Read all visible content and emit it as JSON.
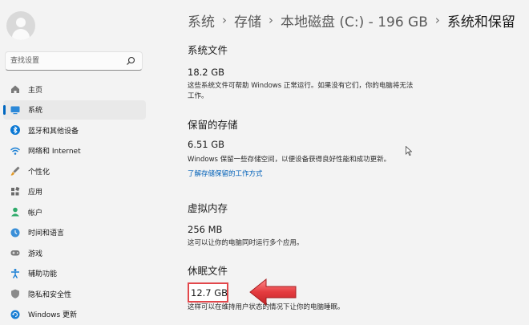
{
  "sidebar": {
    "search_placeholder": "查找设置",
    "items": [
      {
        "label": "主页",
        "icon": "home-icon",
        "active": false
      },
      {
        "label": "系统",
        "icon": "display-icon",
        "active": true
      },
      {
        "label": "蓝牙和其他设备",
        "icon": "bluetooth-icon",
        "active": false
      },
      {
        "label": "网络和 Internet",
        "icon": "wifi-icon",
        "active": false
      },
      {
        "label": "个性化",
        "icon": "brush-icon",
        "active": false
      },
      {
        "label": "应用",
        "icon": "apps-icon",
        "active": false
      },
      {
        "label": "帐户",
        "icon": "account-icon",
        "active": false
      },
      {
        "label": "时间和语言",
        "icon": "globe-clock-icon",
        "active": false
      },
      {
        "label": "游戏",
        "icon": "gamepad-icon",
        "active": false
      },
      {
        "label": "辅助功能",
        "icon": "accessibility-icon",
        "active": false
      },
      {
        "label": "隐私和安全性",
        "icon": "shield-icon",
        "active": false
      },
      {
        "label": "Windows 更新",
        "icon": "windows-update-icon",
        "active": false
      }
    ]
  },
  "breadcrumb": {
    "items": [
      "系统",
      "存储",
      "本地磁盘 (C:) - 196 GB",
      "系统和保留"
    ]
  },
  "sections": {
    "system_files": {
      "title": "系统文件",
      "size": "18.2 GB",
      "description": "这些系统文件可帮助 Windows 正常运行。如果没有它们，你的电脑将无法工作。"
    },
    "reserved_storage": {
      "title": "保留的存储",
      "size": "6.51 GB",
      "description": "Windows 保留一些存储空间，以便设备获得良好性能和成功更新。",
      "link": "了解存储保留的工作方式"
    },
    "virtual_memory": {
      "title": "虚拟内存",
      "size": "256 MB",
      "description": "这可以让你的电脑同时运行多个应用。"
    },
    "hibernation_file": {
      "title": "休眠文件",
      "size": "12.7 GB",
      "description": "这样可以在维持用户状态的情况下让你的电脑睡眠。"
    }
  },
  "colors": {
    "accent": "#0067c0",
    "annotation_red": "#e2474b",
    "background": "#f3f3f3"
  }
}
